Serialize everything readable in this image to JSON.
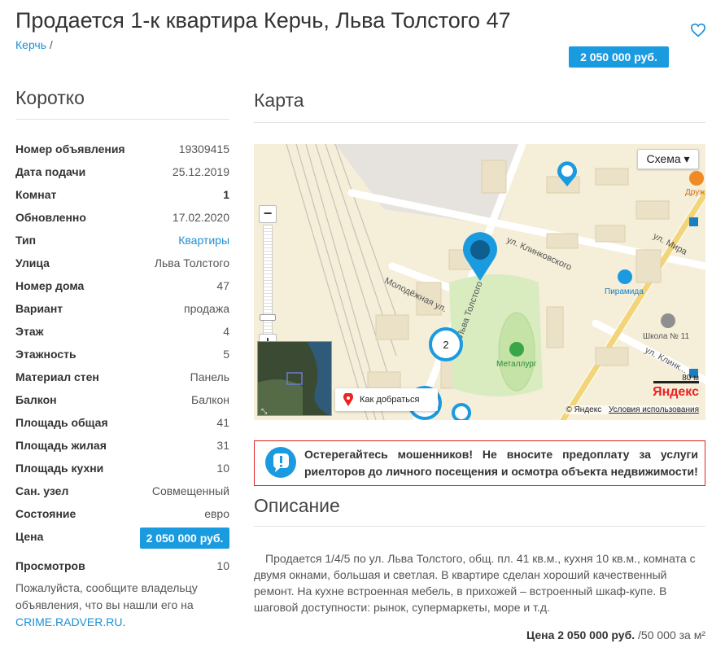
{
  "title": "Продается 1-к квартира Керчь, Льва Толстого 47",
  "breadcrumb": {
    "link": "Керчь",
    "separator": "/"
  },
  "price": "2 050 000 руб.",
  "favorite_icon": "heart-icon",
  "summary": {
    "heading": "Коротко",
    "rows": [
      {
        "label": "Номер объявления",
        "value": "19309415"
      },
      {
        "label": "Дата подачи",
        "value": "25.12.2019"
      },
      {
        "label": "Комнат",
        "value": "1"
      },
      {
        "label": "Обновленно",
        "value": "17.02.2020"
      },
      {
        "label": "Тип",
        "value": "Квартиры"
      },
      {
        "label": "Улица",
        "value": "Льва Толстого"
      },
      {
        "label": "Номер дома",
        "value": "47"
      },
      {
        "label": "Вариант",
        "value": "продажа"
      },
      {
        "label": "Этаж",
        "value": "4"
      },
      {
        "label": "Этажность",
        "value": "5"
      },
      {
        "label": "Материал стен",
        "value": "Панель"
      },
      {
        "label": "Балкон",
        "value": "Балкон"
      },
      {
        "label": "Площадь общая",
        "value": "41"
      },
      {
        "label": "Площадь жилая",
        "value": "31"
      },
      {
        "label": "Площадь кухни",
        "value": "10"
      },
      {
        "label": "Сан. узел",
        "value": "Совмещенный"
      },
      {
        "label": "Состояние",
        "value": "евро"
      },
      {
        "label": "Цена",
        "value": "2 050 000 руб."
      },
      {
        "label": "Просмотров",
        "value": "10"
      }
    ],
    "note_text": "Пожалуйста, сообщите владельцу объявления, что вы нашли его на",
    "note_link": "CRIME.RADVER.RU",
    "note_end": "."
  },
  "map": {
    "heading": "Карта",
    "scheme_button": "Схема ▾",
    "route_button": "Как добраться",
    "copyright": "© Яндекс",
    "terms": "Условия использования",
    "scale": "80 м",
    "logo": "Яндекс",
    "labels": {
      "street_klinkovskogo": "ул. Клинковского",
      "street_molodezhnaya": "Молодёжная ул.",
      "street_tolstogo": "ул. Льва Толстого",
      "street_mira": "ул. Мира",
      "street_klinkovskogo2": "ул. Клинк...",
      "poi_piramida": "Пирамида",
      "poi_shkola": "Школа № 11",
      "poi_metallurg": "Металлург",
      "poi_druzh": "Друж",
      "cluster_1": "2",
      "cluster_2": "2"
    },
    "pin_color": "#1a9be0"
  },
  "warning": {
    "text": "Остерегайтесь мошенников! Не вносите предоплату за услуги риелторов до личного посещения и осмотра объекта недвижимости!"
  },
  "description": {
    "heading": "Описание",
    "text": "Продается 1/4/5 по ул. Льва Толстого, общ. пл. 41 кв.м., кухня 10 кв.м., комната с двумя окнами, большая и светлая. В квартире сделан хороший качественный ремонт. На кухне встроенная мебель, в прихожей – встроенный шкаф-купе. В шаговой доступности: рынок, супермаркеты, море и т.д."
  },
  "footer": {
    "price_label": "Цена 2 050 000 руб.",
    "per_meter": "/50 000 за м²"
  }
}
